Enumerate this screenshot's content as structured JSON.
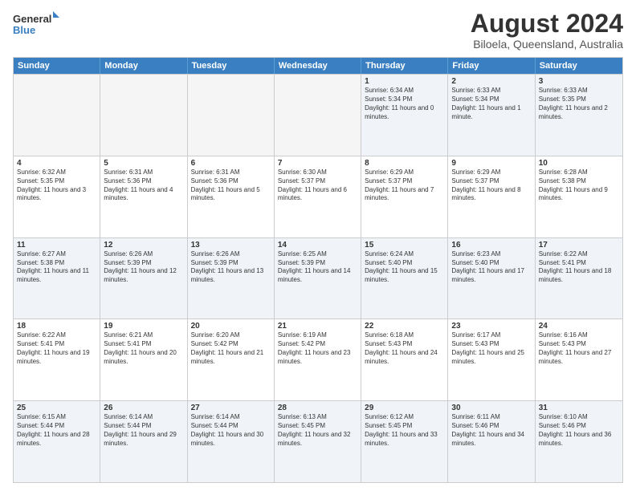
{
  "logo": {
    "line1": "General",
    "line2": "Blue"
  },
  "title": "August 2024",
  "subtitle": "Biloela, Queensland, Australia",
  "header_days": [
    "Sunday",
    "Monday",
    "Tuesday",
    "Wednesday",
    "Thursday",
    "Friday",
    "Saturday"
  ],
  "rows": [
    [
      {
        "day": "",
        "text": ""
      },
      {
        "day": "",
        "text": ""
      },
      {
        "day": "",
        "text": ""
      },
      {
        "day": "",
        "text": ""
      },
      {
        "day": "1",
        "text": "Sunrise: 6:34 AM\nSunset: 5:34 PM\nDaylight: 11 hours and 0 minutes."
      },
      {
        "day": "2",
        "text": "Sunrise: 6:33 AM\nSunset: 5:34 PM\nDaylight: 11 hours and 1 minute."
      },
      {
        "day": "3",
        "text": "Sunrise: 6:33 AM\nSunset: 5:35 PM\nDaylight: 11 hours and 2 minutes."
      }
    ],
    [
      {
        "day": "4",
        "text": "Sunrise: 6:32 AM\nSunset: 5:35 PM\nDaylight: 11 hours and 3 minutes."
      },
      {
        "day": "5",
        "text": "Sunrise: 6:31 AM\nSunset: 5:36 PM\nDaylight: 11 hours and 4 minutes."
      },
      {
        "day": "6",
        "text": "Sunrise: 6:31 AM\nSunset: 5:36 PM\nDaylight: 11 hours and 5 minutes."
      },
      {
        "day": "7",
        "text": "Sunrise: 6:30 AM\nSunset: 5:37 PM\nDaylight: 11 hours and 6 minutes."
      },
      {
        "day": "8",
        "text": "Sunrise: 6:29 AM\nSunset: 5:37 PM\nDaylight: 11 hours and 7 minutes."
      },
      {
        "day": "9",
        "text": "Sunrise: 6:29 AM\nSunset: 5:37 PM\nDaylight: 11 hours and 8 minutes."
      },
      {
        "day": "10",
        "text": "Sunrise: 6:28 AM\nSunset: 5:38 PM\nDaylight: 11 hours and 9 minutes."
      }
    ],
    [
      {
        "day": "11",
        "text": "Sunrise: 6:27 AM\nSunset: 5:38 PM\nDaylight: 11 hours and 11 minutes."
      },
      {
        "day": "12",
        "text": "Sunrise: 6:26 AM\nSunset: 5:39 PM\nDaylight: 11 hours and 12 minutes."
      },
      {
        "day": "13",
        "text": "Sunrise: 6:26 AM\nSunset: 5:39 PM\nDaylight: 11 hours and 13 minutes."
      },
      {
        "day": "14",
        "text": "Sunrise: 6:25 AM\nSunset: 5:39 PM\nDaylight: 11 hours and 14 minutes."
      },
      {
        "day": "15",
        "text": "Sunrise: 6:24 AM\nSunset: 5:40 PM\nDaylight: 11 hours and 15 minutes."
      },
      {
        "day": "16",
        "text": "Sunrise: 6:23 AM\nSunset: 5:40 PM\nDaylight: 11 hours and 17 minutes."
      },
      {
        "day": "17",
        "text": "Sunrise: 6:22 AM\nSunset: 5:41 PM\nDaylight: 11 hours and 18 minutes."
      }
    ],
    [
      {
        "day": "18",
        "text": "Sunrise: 6:22 AM\nSunset: 5:41 PM\nDaylight: 11 hours and 19 minutes."
      },
      {
        "day": "19",
        "text": "Sunrise: 6:21 AM\nSunset: 5:41 PM\nDaylight: 11 hours and 20 minutes."
      },
      {
        "day": "20",
        "text": "Sunrise: 6:20 AM\nSunset: 5:42 PM\nDaylight: 11 hours and 21 minutes."
      },
      {
        "day": "21",
        "text": "Sunrise: 6:19 AM\nSunset: 5:42 PM\nDaylight: 11 hours and 23 minutes."
      },
      {
        "day": "22",
        "text": "Sunrise: 6:18 AM\nSunset: 5:43 PM\nDaylight: 11 hours and 24 minutes."
      },
      {
        "day": "23",
        "text": "Sunrise: 6:17 AM\nSunset: 5:43 PM\nDaylight: 11 hours and 25 minutes."
      },
      {
        "day": "24",
        "text": "Sunrise: 6:16 AM\nSunset: 5:43 PM\nDaylight: 11 hours and 27 minutes."
      }
    ],
    [
      {
        "day": "25",
        "text": "Sunrise: 6:15 AM\nSunset: 5:44 PM\nDaylight: 11 hours and 28 minutes."
      },
      {
        "day": "26",
        "text": "Sunrise: 6:14 AM\nSunset: 5:44 PM\nDaylight: 11 hours and 29 minutes."
      },
      {
        "day": "27",
        "text": "Sunrise: 6:14 AM\nSunset: 5:44 PM\nDaylight: 11 hours and 30 minutes."
      },
      {
        "day": "28",
        "text": "Sunrise: 6:13 AM\nSunset: 5:45 PM\nDaylight: 11 hours and 32 minutes."
      },
      {
        "day": "29",
        "text": "Sunrise: 6:12 AM\nSunset: 5:45 PM\nDaylight: 11 hours and 33 minutes."
      },
      {
        "day": "30",
        "text": "Sunrise: 6:11 AM\nSunset: 5:46 PM\nDaylight: 11 hours and 34 minutes."
      },
      {
        "day": "31",
        "text": "Sunrise: 6:10 AM\nSunset: 5:46 PM\nDaylight: 11 hours and 36 minutes."
      }
    ]
  ]
}
